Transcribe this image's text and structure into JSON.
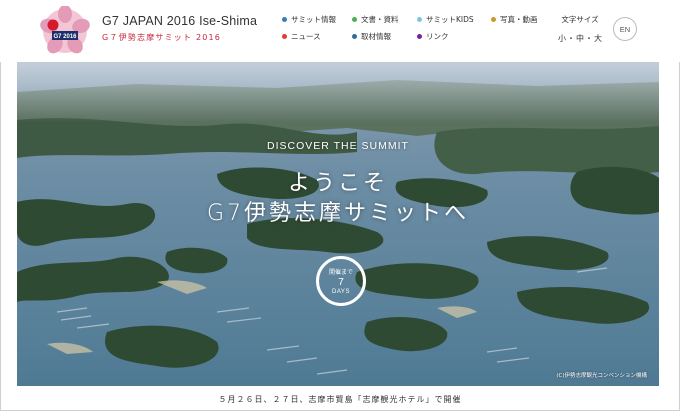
{
  "brand": {
    "title": "G7 JAPAN 2016 Ise-Shima",
    "subtitle": "G７伊勢志摩サミット 2016",
    "logo_text": "G7 2016"
  },
  "nav": [
    {
      "label": "サミット情報",
      "color": "#3a7bb8"
    },
    {
      "label": "文書・資料",
      "color": "#4caf50"
    },
    {
      "label": "サミットKIDS",
      "color": "#7ec5d8"
    },
    {
      "label": "写真・動画",
      "color": "#c79a2a"
    },
    {
      "label": "ニュース",
      "color": "#e53935"
    },
    {
      "label": "取材情報",
      "color": "#2e6e9e"
    },
    {
      "label": "リンク",
      "color": "#7b1fa2"
    }
  ],
  "font_size": {
    "label": "文字サイズ",
    "options": [
      "小",
      "・",
      "中",
      "・",
      "大"
    ]
  },
  "lang": {
    "label": "EN"
  },
  "hero": {
    "kicker": "DISCOVER THE SUMMIT",
    "title_line1": "ようこそ",
    "title_line2": "G7伊勢志摩サミットへ",
    "countdown_label": "開催まで",
    "countdown_value": "7",
    "countdown_unit": "DAYS",
    "credit": "(C)伊勢志摩観光コンベンション機構"
  },
  "footer_note": "５月２６日、２７日、志摩市賢島「志摩観光ホテル」で開催"
}
